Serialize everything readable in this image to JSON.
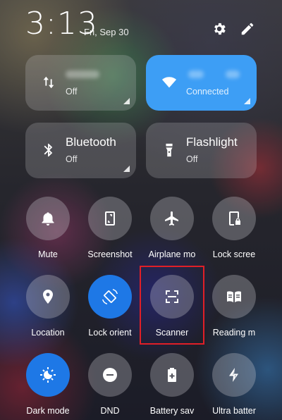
{
  "status": {
    "time": "3:13",
    "date": "Fri, Sep 30"
  },
  "header_icons": [
    {
      "name": "settings-gear-icon"
    },
    {
      "name": "edit-pencil-icon"
    }
  ],
  "tiles": [
    {
      "title": "",
      "status": "Off",
      "icon": "mobile-data-arrows-icon",
      "active": false
    },
    {
      "title": "",
      "status": "Connected",
      "icon": "wifi-icon",
      "active": true
    },
    {
      "title": "Bluetooth",
      "status": "Off",
      "icon": "bluetooth-icon",
      "active": false
    },
    {
      "title": "Flashlight",
      "status": "Off",
      "icon": "flashlight-icon",
      "active": false
    }
  ],
  "toggles": [
    {
      "label": "Mute",
      "icon": "bell-icon",
      "active": false
    },
    {
      "label": "Screenshot",
      "icon": "phone-screenshot-icon",
      "active": false
    },
    {
      "label": "Airplane mo",
      "icon": "airplane-icon",
      "active": false
    },
    {
      "label": "Lock scree",
      "icon": "lock-screen-icon",
      "active": false
    },
    {
      "label": "Location",
      "icon": "location-pin-icon",
      "active": false
    },
    {
      "label": "Lock orient",
      "icon": "rotation-lock-icon",
      "active": true
    },
    {
      "label": "Scanner",
      "icon": "scanner-icon",
      "active": false
    },
    {
      "label": "Reading m",
      "icon": "book-icon",
      "active": false
    },
    {
      "label": "Dark mode",
      "icon": "dark-mode-icon",
      "active": true
    },
    {
      "label": "DND",
      "icon": "minus-circle-icon",
      "active": false
    },
    {
      "label": "Battery sav",
      "icon": "battery-plus-icon",
      "active": false
    },
    {
      "label": "Ultra batter",
      "icon": "lightning-bolt-icon",
      "active": false
    }
  ],
  "colors": {
    "accent": "#1e78e6",
    "tile_active": "#3d9ef5",
    "highlight": "#e01f27"
  }
}
